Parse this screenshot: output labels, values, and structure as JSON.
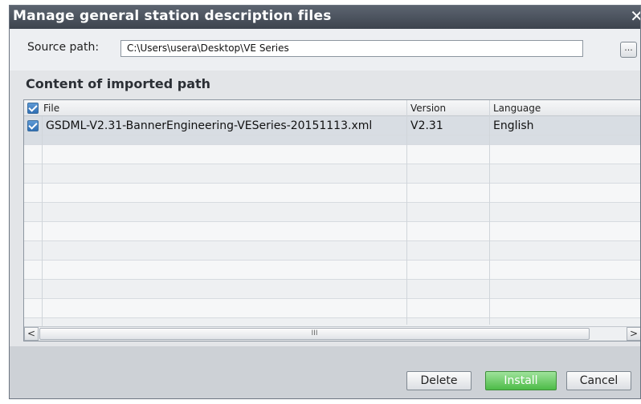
{
  "dialog": {
    "title": "Manage general station description files",
    "close_glyph": "✕"
  },
  "source": {
    "label": "Source path:",
    "value": "C:\\Users\\usera\\Desktop\\VE Series",
    "browse_label": "..."
  },
  "section_title": "Content of imported path",
  "table": {
    "columns": [
      "File",
      "Version",
      "Language"
    ],
    "rows": [
      {
        "checked": true,
        "file": "GSDML-V2.31-BannerEngineering-VESeries-20151113.xml",
        "version": "V2.31",
        "language": "English"
      }
    ]
  },
  "scrollbar": {
    "left_glyph": "<",
    "right_glyph": ">",
    "thumb_grip": "III"
  },
  "buttons": {
    "delete": "Delete",
    "install": "Install",
    "cancel": "Cancel"
  },
  "colors": {
    "titlebar": "#4a515b",
    "install_accent": "#4dbb48",
    "checkbox": "#2f6eb3"
  }
}
